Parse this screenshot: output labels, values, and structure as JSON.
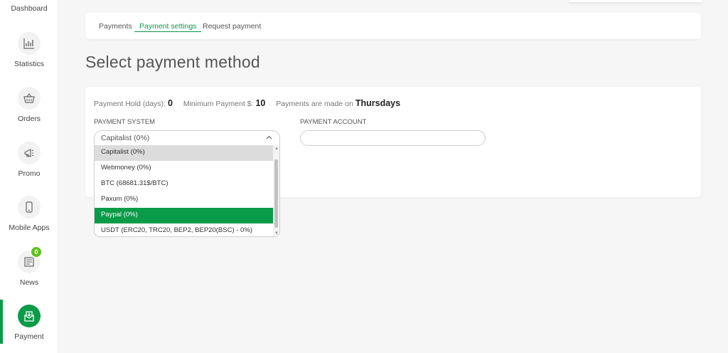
{
  "sidebar": {
    "items": [
      {
        "label": "Dashboard",
        "icon": "dashboard-icon"
      },
      {
        "label": "Statistics",
        "icon": "statistics-icon"
      },
      {
        "label": "Orders",
        "icon": "basket-icon"
      },
      {
        "label": "Promo",
        "icon": "megaphone-icon"
      },
      {
        "label": "Mobile Apps",
        "icon": "smartphone-icon"
      },
      {
        "label": "News",
        "icon": "newspaper-icon",
        "badge": "0"
      },
      {
        "label": "Payment",
        "icon": "payment-envelope-icon",
        "active": true
      }
    ]
  },
  "tabs": [
    {
      "label": "Payments"
    },
    {
      "label": "Payment settings",
      "active": true
    },
    {
      "label": "Request payment"
    }
  ],
  "page_title": "Select payment method",
  "info": {
    "hold_label": "Payment Hold (days):",
    "hold_value": "0",
    "min_label": "Minimum Payment $:",
    "min_value": "10",
    "schedule_label": "Payments are made on",
    "schedule_value": "Thursdays"
  },
  "payment_system": {
    "label": "PAYMENT SYSTEM",
    "selected": "Capitalist (0%)",
    "options": [
      {
        "label": "Capitalist (0%)",
        "state": "selected"
      },
      {
        "label": "Webmoney (0%)"
      },
      {
        "label": "BTC (68681.31$/BTC)"
      },
      {
        "label": "Paxum (0%)"
      },
      {
        "label": "Paypal (0%)",
        "state": "hover"
      },
      {
        "label": "USDT (ERC20, TRC20, BEP2, BEP20(BSC) - 0%)"
      }
    ]
  },
  "payment_account": {
    "label": "PAYMENT ACCOUNT",
    "value": ""
  },
  "colors": {
    "accent": "#0a9b48",
    "badge": "#5ec21e",
    "background": "#f6f6f6"
  }
}
